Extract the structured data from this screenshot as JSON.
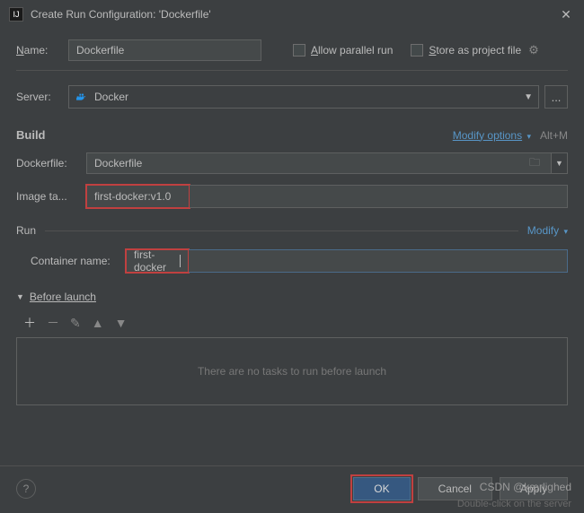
{
  "titlebar": {
    "title": "Create Run Configuration: 'Dockerfile'"
  },
  "name": {
    "label": "Name:",
    "value": "Dockerfile"
  },
  "checkboxes": {
    "allow_parallel": "Allow parallel run",
    "store_project": "Store as project file"
  },
  "server": {
    "label": "Server:",
    "value": "Docker",
    "dots": "..."
  },
  "build": {
    "title": "Build",
    "modify": "Modify options",
    "shortcut": "Alt+M",
    "dockerfile_label": "Dockerfile:",
    "dockerfile_value": "Dockerfile",
    "image_tag_label": "Image ta...",
    "image_tag_value": "first-docker:v1.0"
  },
  "run": {
    "title": "Run",
    "modify": "Modify",
    "container_label": "Container name:",
    "container_value": "first-docker"
  },
  "before_launch": {
    "title": "Before launch",
    "empty_text": "There are no tasks to run before launch"
  },
  "footer": {
    "ok": "OK",
    "cancel": "Cancel",
    "apply": "Apply",
    "help": "?"
  },
  "watermark": "CSDN @kærlighed",
  "watermark2": "Double-click on the server"
}
